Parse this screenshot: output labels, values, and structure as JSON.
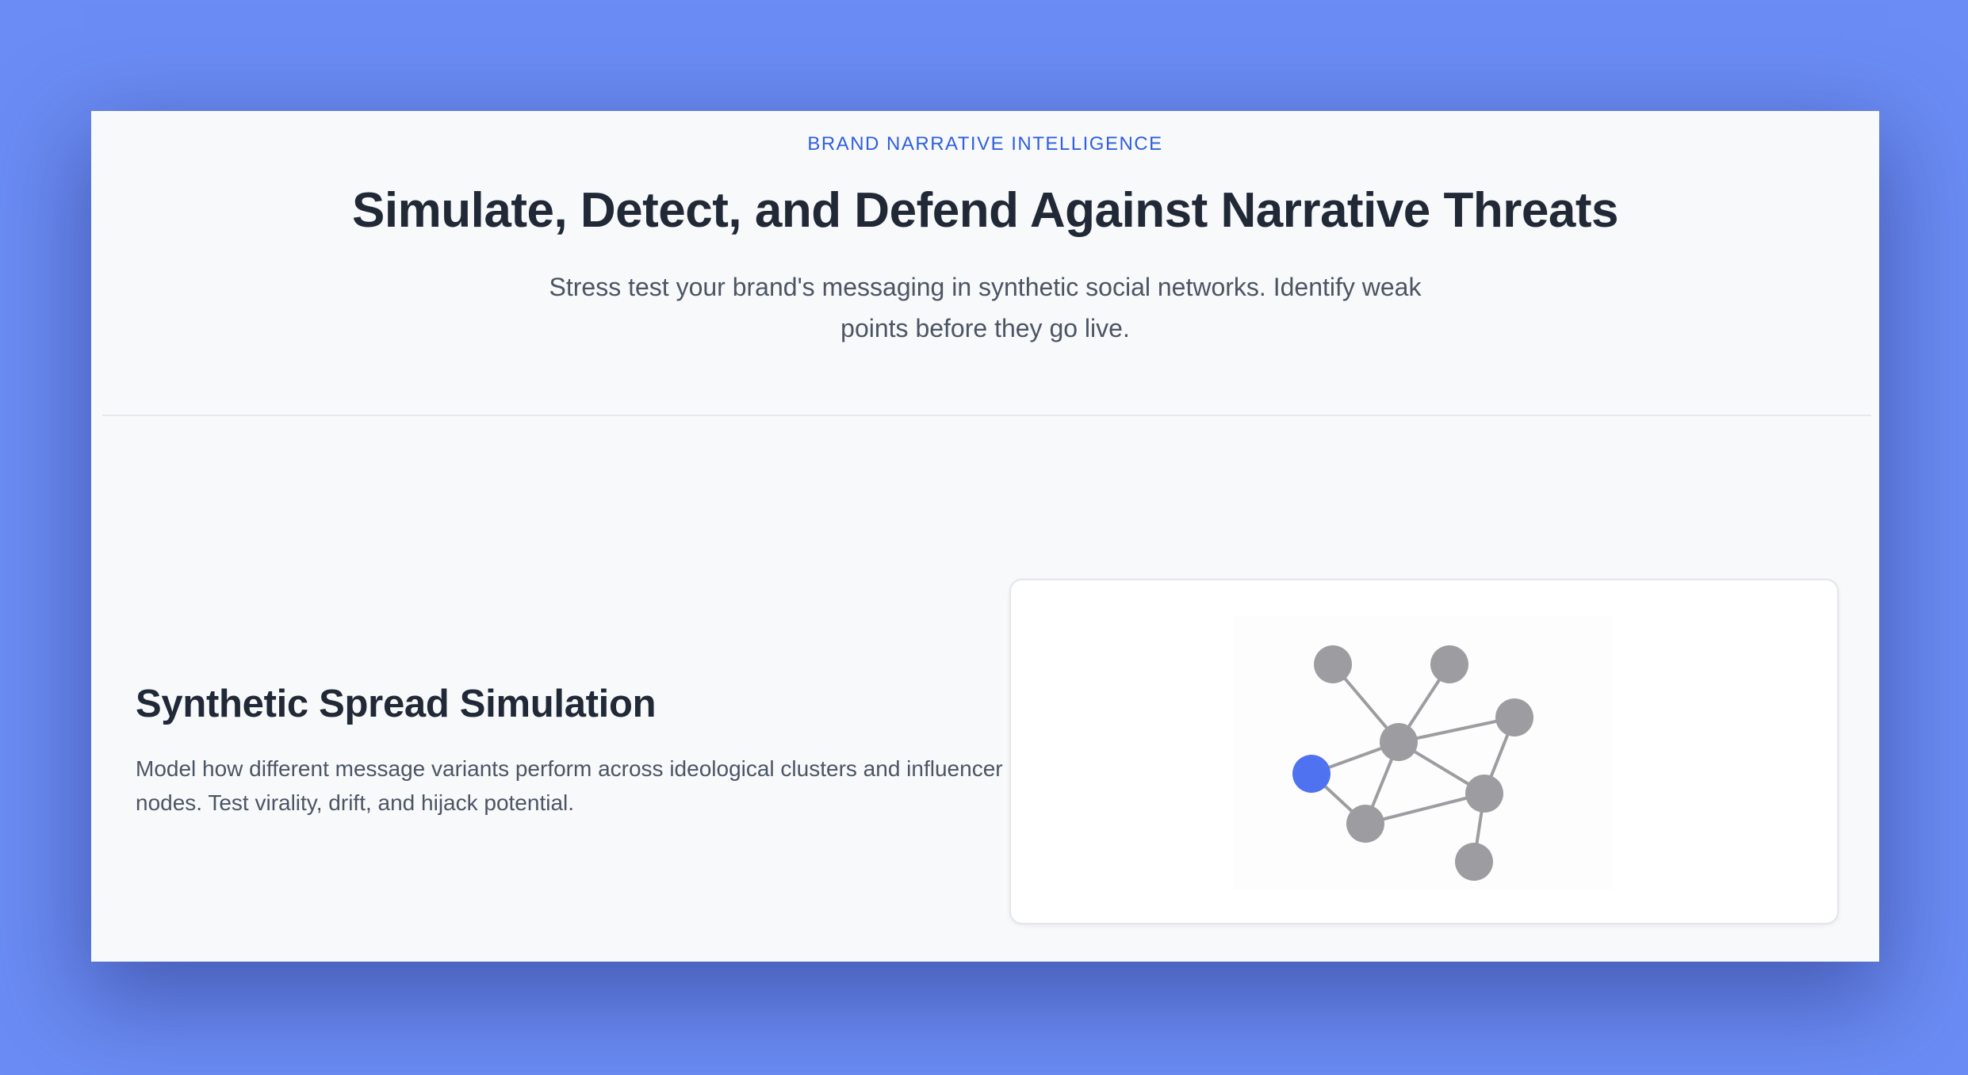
{
  "hero": {
    "eyebrow": "BRAND NARRATIVE INTELLIGENCE",
    "title": "Simulate, Detect, and Defend Against Narrative Threats",
    "subtitle": "Stress test your brand's messaging in synthetic social networks. Identify weak points before they go live."
  },
  "feature": {
    "title": "Synthetic Spread Simulation",
    "description": "Model how different message variants perform across ideological clusters and influencer nodes. Test virality, drift, and hijack potential."
  },
  "colors": {
    "background": "#6b8cf4",
    "accent": "#2f5fe0",
    "seed_node": "#4f72f0",
    "node": "#9d9da1",
    "edge": "#9d9da1"
  }
}
